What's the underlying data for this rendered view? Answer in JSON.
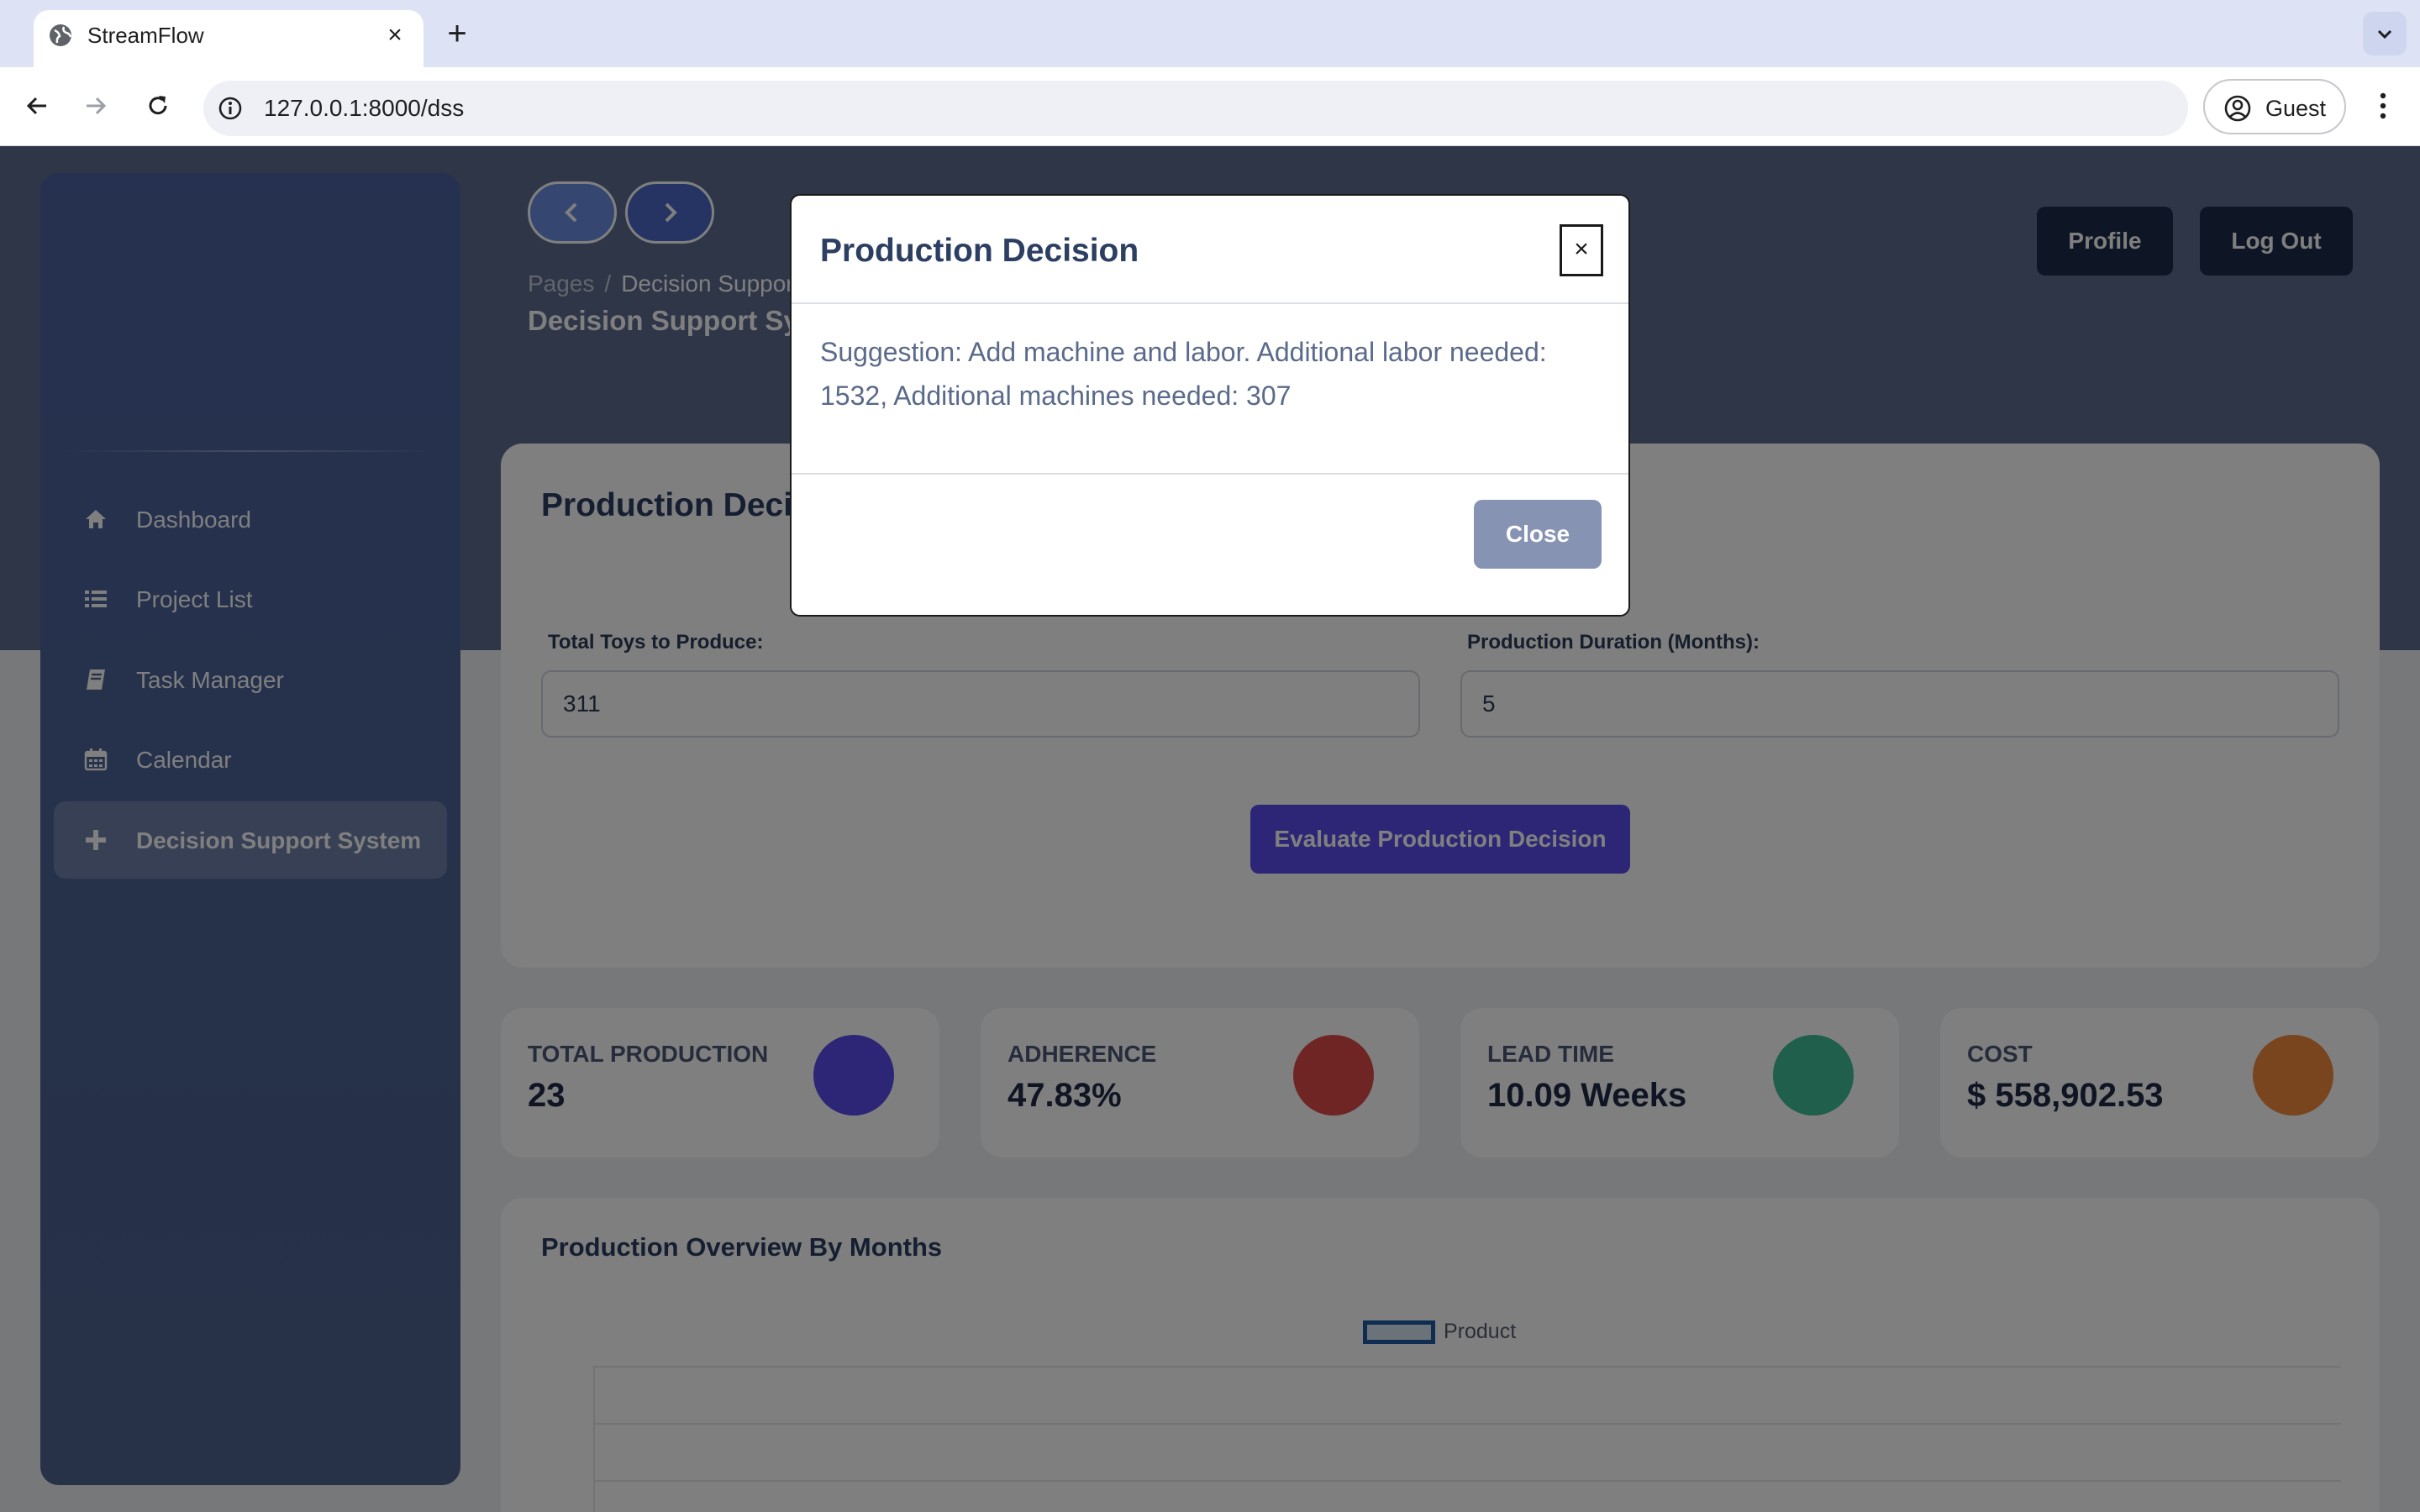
{
  "browser": {
    "tab_title": "StreamFlow",
    "tab_close_glyph": "×",
    "new_tab_glyph": "+",
    "url": "127.0.0.1:8000/dss",
    "profile_label": "Guest"
  },
  "sidebar": {
    "items": [
      {
        "label": "Dashboard",
        "icon": "home-icon",
        "active": false
      },
      {
        "label": "Project List",
        "icon": "list-icon",
        "active": false
      },
      {
        "label": "Task Manager",
        "icon": "book-icon",
        "active": false
      },
      {
        "label": "Calendar",
        "icon": "calendar-icon",
        "active": false
      },
      {
        "label": "Decision Support System",
        "icon": "plus-icon",
        "active": true
      }
    ]
  },
  "header": {
    "breadcrumb_root": "Pages",
    "breadcrumb_sep": "/",
    "breadcrumb_current": "Decision Support System",
    "title": "Decision Support System",
    "profile_button": "Profile",
    "logout_button": "Log Out"
  },
  "form": {
    "title": "Production Decision",
    "toys_label": "Total Toys to Produce:",
    "toys_value": "311",
    "duration_label": "Production Duration (Months):",
    "duration_value": "5",
    "evaluate_button": "Evaluate Production Decision"
  },
  "stats": [
    {
      "label": "TOTAL PRODUCTION",
      "value": "23",
      "color": "#5b4ded"
    },
    {
      "label": "ADHERENCE",
      "value": "47.83%",
      "color": "#e04a4a"
    },
    {
      "label": "LEAD TIME",
      "value": "10.09 Weeks",
      "color": "#3fbf98"
    },
    {
      "label": "COST",
      "value": "$ 558,902.53",
      "color": "#f08a3c"
    }
  ],
  "chart": {
    "title": "Production Overview By Months",
    "legend_label": "Product"
  },
  "chart_data": {
    "type": "bar",
    "title": "Production Overview By Months",
    "series": [
      {
        "name": "Product",
        "values": []
      }
    ],
    "categories": []
  },
  "modal": {
    "title": "Production Decision",
    "close_x": "×",
    "body": "Suggestion: Add machine and labor. Additional labor needed: 1532, Additional machines needed: 307",
    "close_button": "Close"
  },
  "colors": {
    "accent": "#5b4ded",
    "sidebar": "#4d6295",
    "header_button": "#1c2a4b"
  }
}
